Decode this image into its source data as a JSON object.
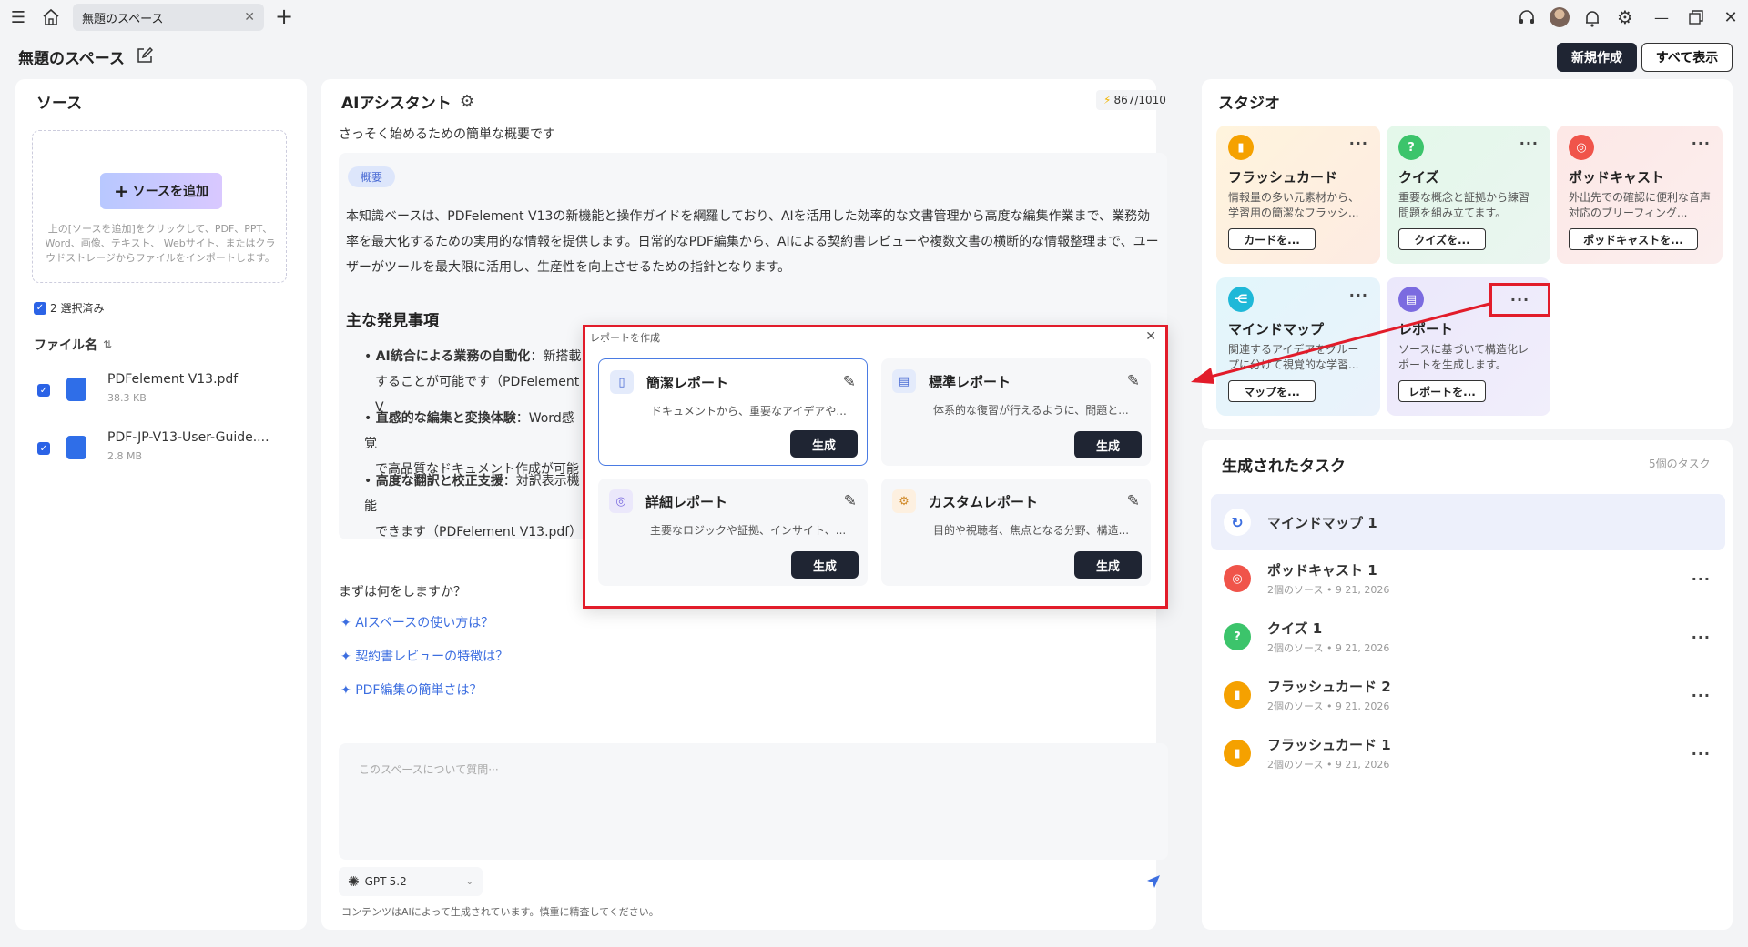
{
  "tab": {
    "title": "無題のスペース"
  },
  "header": {
    "title": "無題のスペース",
    "new_button": "新規作成",
    "show_all_button": "すべて表示"
  },
  "sources": {
    "title": "ソース",
    "add_button": "ソースを追加",
    "add_hint": "上の[ソースを追加]をクリックして、PDF、PPT、Word、画像、テキスト、 Webサイト、またはクラウドストレージからファイルをインポートします。",
    "selected": "2 選択済み",
    "file_header": "ファイル名",
    "files": [
      {
        "name": "PDFelement V13.pdf",
        "size": "38.3 KB"
      },
      {
        "name": "PDF-JP-V13-User-Guide....",
        "size": "2.8 MB"
      }
    ]
  },
  "assistant": {
    "title": "AIアシスタント",
    "credits": "867/1010",
    "subtitle": "さっそく始めるための簡単な概要です",
    "summary_tag": "概要",
    "summary_text": "本知識ベースは、PDFelement V13の新機能と操作ガイドを網羅しており、AIを活用した効率的な文書管理から高度な編集作業まで、業務効率を最大化するための実用的な情報を提供します。日常的なPDF編集から、AIによる契約書レビューや複数文書の横断的な情報整理まで、ユーザーがツールを最大限に活用し、生産性を向上させるための指針となります。",
    "findings_title": "主な発見事項",
    "findings": [
      {
        "bold": "AI統合による業務の自動化",
        "rest": "：新搭載",
        "line2": "することが可能です（PDFelement V"
      },
      {
        "bold": "直感的な編集と変換体験",
        "rest": "：Word感覚",
        "line2": "で高品質なドキュメント作成が可能"
      },
      {
        "bold": "高度な翻訳と校正支援",
        "rest": "：対訳表示機能",
        "line2": "できます（PDFelement V13.pdf）"
      }
    ],
    "prompt_title": "まずは何をしますか？",
    "suggestions": [
      "AIスペースの使い方は？",
      "契約書レビューの特徴は？",
      "PDF編集の簡単さは？"
    ],
    "input_placeholder": "このスペースについて質問···",
    "model": "GPT-5.2",
    "disclaimer": "コンテンツはAIによって生成されています。慎重に精査してください。"
  },
  "studio": {
    "title": "スタジオ",
    "cards": [
      {
        "title": "フラッシュカード",
        "desc": "情報量の多い元素材から、学習用の簡潔なフラッシ...",
        "button": "カードを..."
      },
      {
        "title": "クイズ",
        "desc": "重要な概念と証拠から練習問題を組み立てます。",
        "button": "クイズを..."
      },
      {
        "title": "ポッドキャスト",
        "desc": "外出先での確認に便利な音声対応のブリーフィング...",
        "button": "ポッドキャストを..."
      },
      {
        "title": "マインドマップ",
        "desc": "関連するアイデアをグループに分けて視覚的な学習...",
        "button": "マップを..."
      },
      {
        "title": "レポート",
        "desc": "ソースに基づいて構造化レポートを生成します。",
        "button": "レポートを..."
      }
    ]
  },
  "tasks": {
    "title": "生成されたタスク",
    "count": "5個のタスク",
    "items": [
      {
        "name": "マインドマップ 1",
        "meta": ""
      },
      {
        "name": "ポッドキャスト 1",
        "meta": "2個のソース • 9 21, 2026"
      },
      {
        "name": "クイズ 1",
        "meta": "2個のソース • 9 21, 2026"
      },
      {
        "name": "フラッシュカード 2",
        "meta": "2個のソース • 9 21, 2026"
      },
      {
        "name": "フラッシュカード 1",
        "meta": "2個のソース • 9 21, 2026"
      }
    ]
  },
  "modal": {
    "title": "レポートを作成",
    "generate_label": "生成",
    "cards": [
      {
        "title": "簡潔レポート",
        "desc": "ドキュメントから、重要なアイデアや..."
      },
      {
        "title": "標準レポート",
        "desc": "体系的な復習が行えるように、問題と..."
      },
      {
        "title": "詳細レポート",
        "desc": "主要なロジックや証拠、インサイト、..."
      },
      {
        "title": "カスタムレポート",
        "desc": "目的や視聴者、焦点となる分野、構造..."
      }
    ]
  },
  "colors": {
    "accent": "#2b63e6",
    "highlight": "#e21c2a",
    "dark": "#1f2533"
  }
}
